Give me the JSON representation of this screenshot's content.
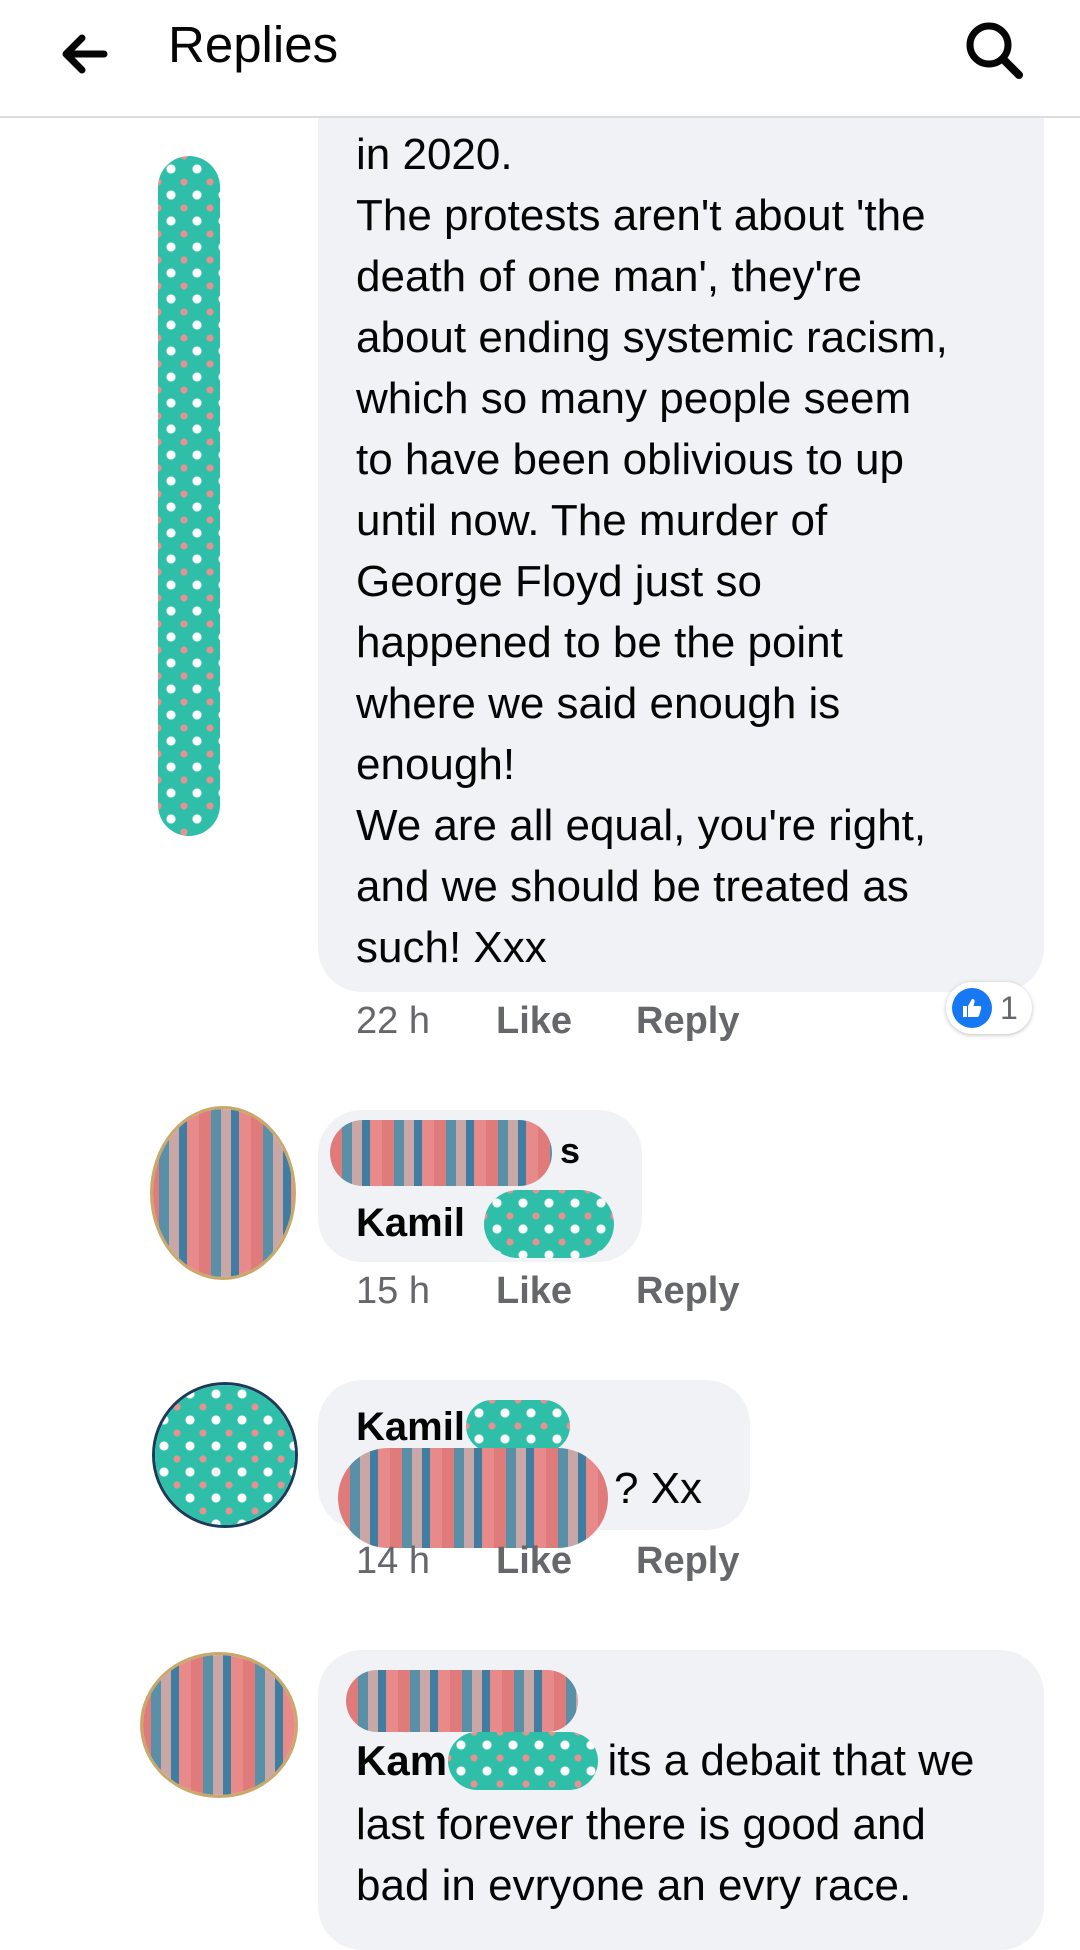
{
  "header": {
    "title": "Replies",
    "back_icon": "arrow-left-icon",
    "search_icon": "search-icon"
  },
  "comments": [
    {
      "text_lines": [
        "in 2020.",
        "The protests aren't about 'the",
        "death of one man', they're",
        "about ending systemic racism,",
        "which so many people seem",
        "to have been oblivious to up",
        "until now. The murder of",
        "George Floyd just so",
        "happened to be the point",
        "where we said enough is",
        "enough!",
        "We are all equal, you're right,",
        "and we should be treated as",
        "such! Xxx"
      ],
      "time": "22 h",
      "like_label": "Like",
      "reply_label": "Reply",
      "reaction_count": "1"
    },
    {
      "author_suffix": "s",
      "mention": "Kamil",
      "time": "15 h",
      "like_label": "Like",
      "reply_label": "Reply"
    },
    {
      "author": "Kamil",
      "text": "? Xx",
      "time": "14 h",
      "like_label": "Like",
      "reply_label": "Reply"
    },
    {
      "mention": "Kam",
      "text_after_mention": "its a debait that we",
      "text_lines": [
        "last forever there is good and",
        "bad in evryone an evry race."
      ]
    }
  ],
  "colors": {
    "bubble": "#f0f2f5",
    "meta": "#65676b",
    "like_blue": "#1877f2",
    "redaction_teal": "#2fbfa8"
  }
}
